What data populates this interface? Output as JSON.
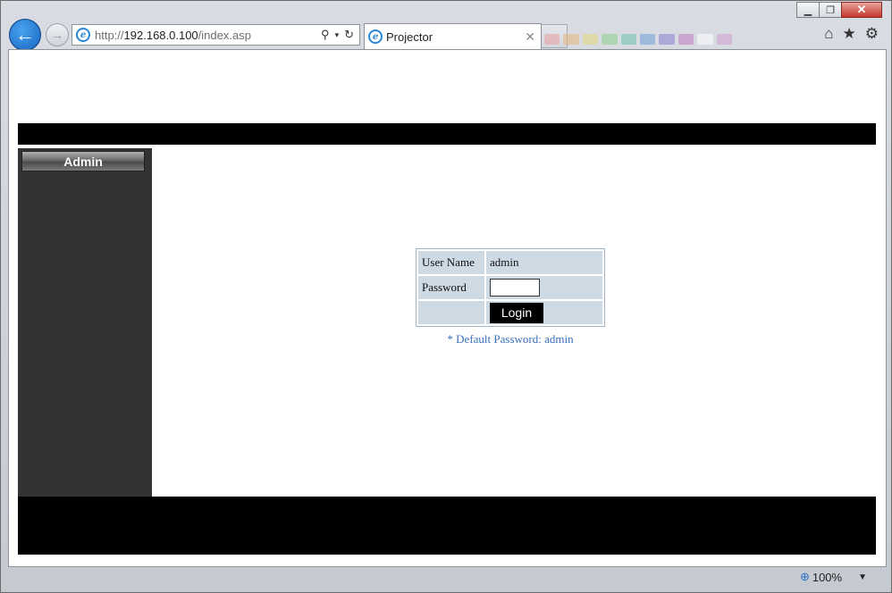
{
  "browser": {
    "url_prefix": "http://",
    "url_host": "192.168.0.100",
    "url_path": "/index.asp",
    "tab_title": "Projector",
    "zoom": "100%",
    "icons": [
      "back-arrow-icon",
      "forward-arrow-icon",
      "ie-logo-icon",
      "search-icon",
      "refresh-icon",
      "close-icon",
      "home-icon",
      "star-icon",
      "gear-icon",
      "zoom-icon",
      "minimize-icon",
      "restore-icon"
    ]
  },
  "sidebar": {
    "admin_label": "Admin"
  },
  "login": {
    "username_label": "User Name",
    "username_value": "admin",
    "password_label": "Password",
    "password_value": "",
    "login_label": "Login",
    "default_note": "* Default Password: admin"
  },
  "colors": {
    "bar": "#000000",
    "sidebar": "#333333",
    "cell": "#cdd9e3",
    "note": "#3a6fba"
  }
}
